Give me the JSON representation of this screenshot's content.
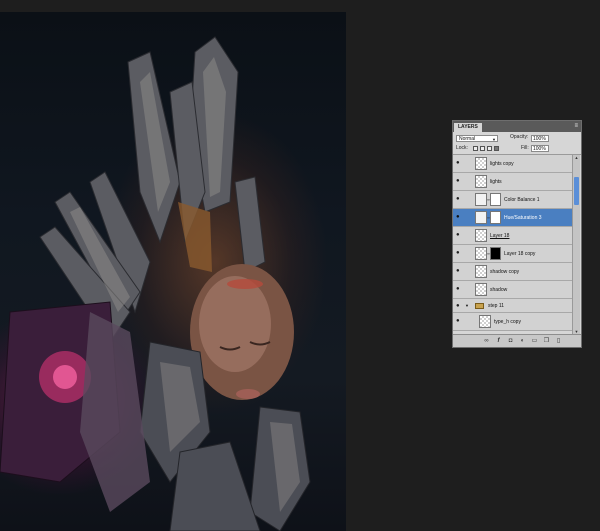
{
  "panel": {
    "tab_label": "LAYERS",
    "menu_glyph": "≡",
    "blend_mode": "Normal",
    "opacity_label": "Opacity:",
    "opacity_value": "100%",
    "lock_label": "Lock:",
    "fill_label": "Fill:",
    "fill_value": "100%"
  },
  "layers": [
    {
      "name": "lights copy",
      "type": "pixel",
      "visible": true
    },
    {
      "name": "lights",
      "type": "pixel",
      "visible": true
    },
    {
      "name": "Color Balance 1",
      "type": "adjustment",
      "icon": "balance-icon",
      "visible": true
    },
    {
      "name": "Hue/Saturation 3",
      "type": "adjustment",
      "icon": "hue-icon",
      "visible": true,
      "selected": true
    },
    {
      "name": "Layer 18",
      "type": "pixel",
      "visible": true
    },
    {
      "name": "Layer 18 copy",
      "type": "pixel-masked",
      "visible": true
    },
    {
      "name": "shadow copy",
      "type": "pixel",
      "visible": true
    },
    {
      "name": "shadow",
      "type": "pixel",
      "visible": true
    },
    {
      "name": "step 11",
      "type": "group",
      "visible": true
    },
    {
      "name": "type_h copy",
      "type": "pixel",
      "visible": true
    }
  ],
  "bottom_icons": [
    "link-icon",
    "fx-icon",
    "mask-icon",
    "adjustment-icon",
    "folder-icon",
    "new-layer-icon",
    "trash-icon"
  ],
  "colors": {
    "selection": "#4a7fc1",
    "panel": "#d6d6d6",
    "background": "#1e1e1e"
  }
}
